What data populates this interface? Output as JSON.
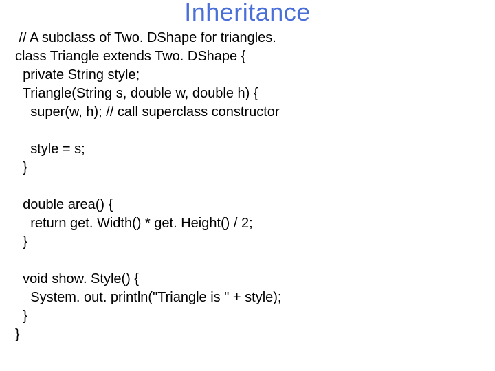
{
  "slide": {
    "title": "Inheritance",
    "code": {
      "l01": " // A subclass of Two. DShape for triangles.",
      "l02": "class Triangle extends Two. DShape {",
      "l03": "  private String style;",
      "l04": "  Triangle(String s, double w, double h) {",
      "l05": "    super(w, h); // call superclass constructor",
      "l06": "",
      "l07": "    style = s;",
      "l08": "  }",
      "l09": "",
      "l10": "  double area() {",
      "l11": "    return get. Width() * get. Height() / 2;",
      "l12": "  }",
      "l13": "",
      "l14": "  void show. Style() {",
      "l15": "    System. out. println(\"Triangle is \" + style);",
      "l16": "  }",
      "l17": "}"
    }
  }
}
